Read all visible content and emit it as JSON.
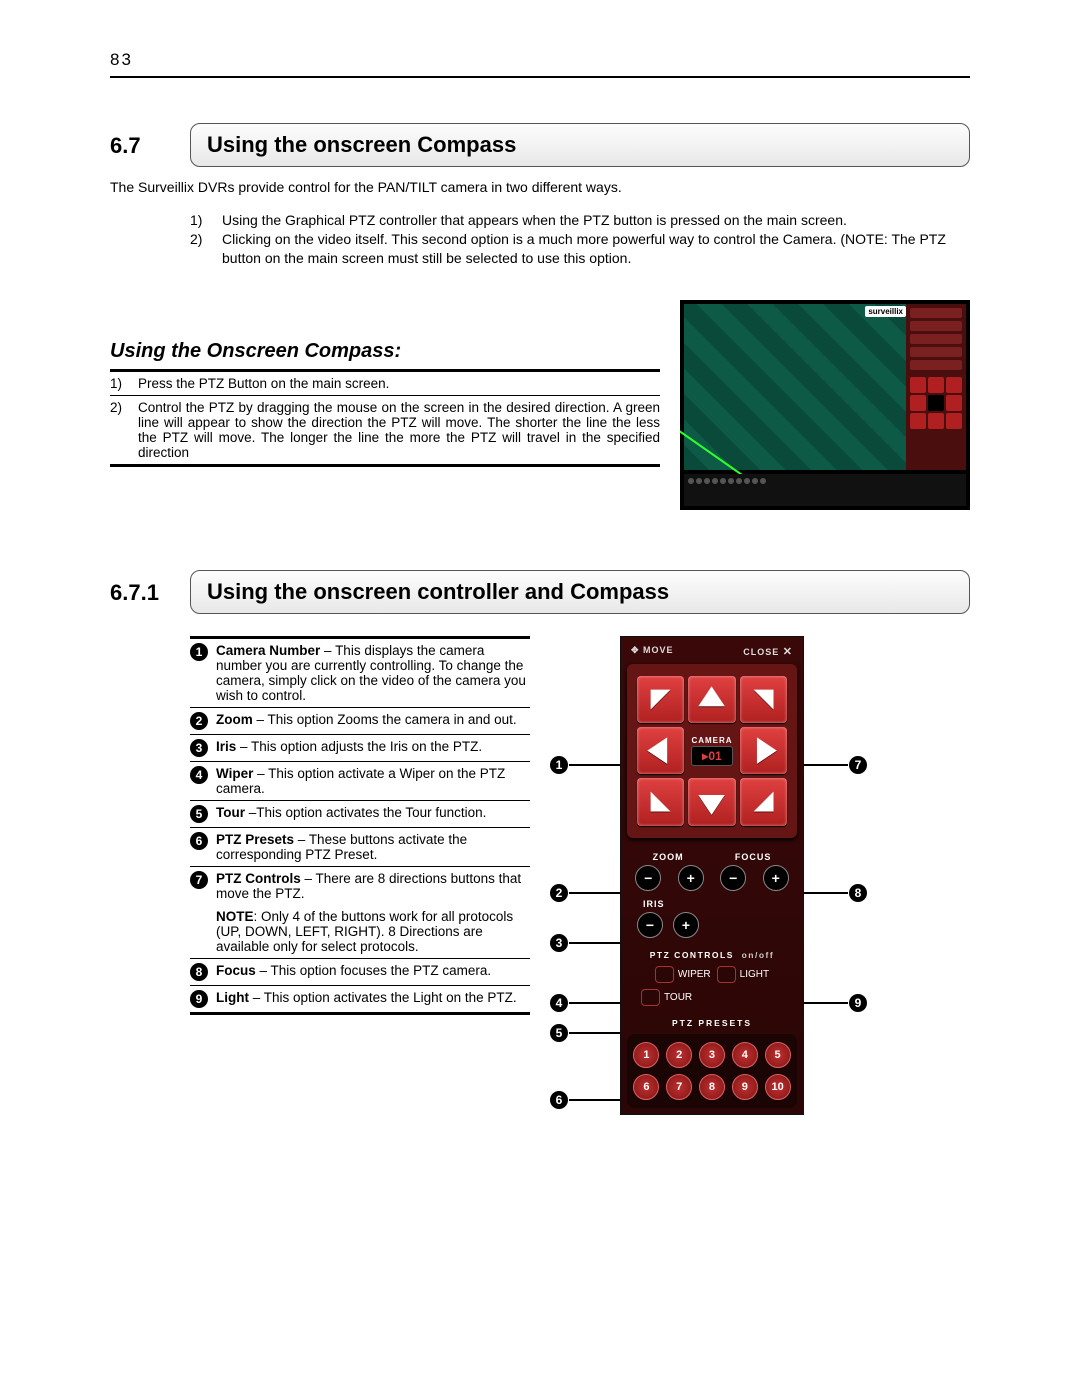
{
  "page_number": "83",
  "s1": {
    "num": "6.7",
    "title": "Using the onscreen Compass",
    "intro": "The Surveillix DVRs provide control for the PAN/TILT camera in two different ways.",
    "list": [
      {
        "n": "1)",
        "t": "Using the Graphical PTZ controller that appears when the PTZ button is pressed on the main screen."
      },
      {
        "n": "2)",
        "t": "Clicking on the video itself.  This second option is a much more powerful way to control the Camera.  (NOTE: The PTZ button on the main screen must still be selected to use this option."
      }
    ],
    "sub_h": "Using the Onscreen Compass:",
    "steps": [
      {
        "n": "1)",
        "t": "Press the PTZ Button on the main screen."
      },
      {
        "n": "2)",
        "t": "Control the PTZ by dragging the mouse on the screen in the desired direction. A green line will appear to show the direction the PTZ will move.  The shorter the line the less the PTZ will move.  The longer the line the more the PTZ will travel in the specified direction"
      }
    ],
    "shot_logo": "surveillix"
  },
  "s2": {
    "num": "6.7.1",
    "title": "Using the onscreen controller and Compass",
    "legend": [
      {
        "n": "1",
        "b": "Camera Number",
        "t": " – This displays the camera number you are currently controlling. To change the camera, simply click on the video of the camera you wish to control."
      },
      {
        "n": "2",
        "b": "Zoom",
        "t": " – This option Zooms the camera in and out."
      },
      {
        "n": "3",
        "b": "Iris",
        "t": " – This option adjusts the Iris on the PTZ."
      },
      {
        "n": "4",
        "b": "Wiper",
        "t": " – This option activate a Wiper on the PTZ camera."
      },
      {
        "n": "5",
        "b": "Tour",
        "t": " –This option activates the Tour function."
      },
      {
        "n": "6",
        "b": "PTZ Presets",
        "t": " – These buttons activate the corresponding PTZ Preset."
      },
      {
        "n": "7",
        "b": "PTZ Controls",
        "t": " – There are 8 directions buttons that move the PTZ."
      },
      {
        "n": "7note",
        "b": "",
        "t": "NOTE: Only 4 of the buttons work for all protocols (UP, DOWN, LEFT, RIGHT). 8 Directions are available only for select protocols.",
        "note": true
      },
      {
        "n": "8",
        "b": "Focus",
        "t": " – This option focuses the PTZ camera."
      },
      {
        "n": "9",
        "b": "Light",
        "t": " – This option activates the Light on the PTZ."
      }
    ]
  },
  "ctl": {
    "move": "MOVE",
    "close": "CLOSE",
    "camera": "CAMERA",
    "cam_num": "01",
    "zoom": "ZOOM",
    "focus": "FOCUS",
    "iris": "IRIS",
    "ptzctl": "PTZ CONTROLS",
    "onoff": "on/off",
    "wiper": "WIPER",
    "light": "LIGHT",
    "tour": "TOUR",
    "presets_lbl": "PTZ PRESETS",
    "presets": [
      "1",
      "2",
      "3",
      "4",
      "5",
      "6",
      "7",
      "8",
      "9",
      "10"
    ]
  }
}
